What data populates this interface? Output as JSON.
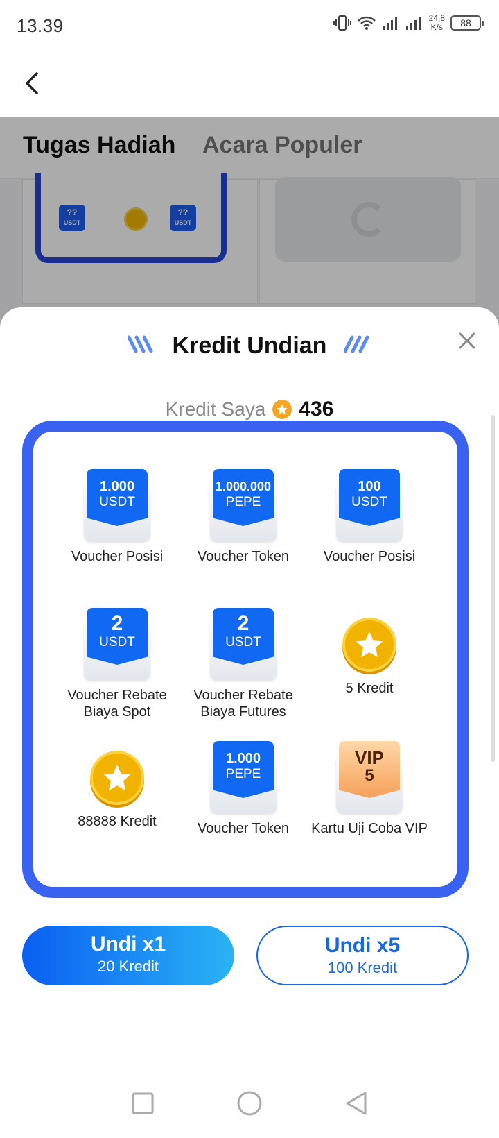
{
  "status_bar": {
    "time": "13.39",
    "net_speed_value": "24,8",
    "net_speed_unit": "K/s",
    "battery": "88"
  },
  "tabs": [
    {
      "label": "Tugas Hadiah"
    },
    {
      "label": "Acara Populer"
    }
  ],
  "background_card": {
    "mini_voucher_label_1": "??",
    "mini_voucher_unit_1": "USDT",
    "mini_voucher_label_2": "??",
    "mini_voucher_unit_2": "USDT"
  },
  "sheet": {
    "title": "Kredit Undian",
    "credit_label": "Kredit Saya",
    "credit_value": "436",
    "prizes": [
      {
        "kind": "voucher",
        "amount": "1.000",
        "unit": "USDT",
        "label": "Voucher Posisi"
      },
      {
        "kind": "voucher",
        "amount": "1.000.000",
        "unit": "PEPE",
        "label": "Voucher Token"
      },
      {
        "kind": "voucher",
        "amount": "100",
        "unit": "USDT",
        "label": "Voucher Posisi"
      },
      {
        "kind": "voucher",
        "amount": "2",
        "unit": "USDT",
        "label": "Voucher Rebate Biaya Spot"
      },
      {
        "kind": "voucher",
        "amount": "2",
        "unit": "USDT",
        "label": "Voucher Rebate Biaya Futures"
      },
      {
        "kind": "coin",
        "label": "5 Kredit"
      },
      {
        "kind": "coin",
        "label": "88888 Kredit"
      },
      {
        "kind": "voucher",
        "amount": "1.000",
        "unit": "PEPE",
        "label": "Voucher Token"
      },
      {
        "kind": "vip",
        "amount": "VIP",
        "unit": "5",
        "label": "Kartu Uji Coba VIP"
      }
    ],
    "buttons": [
      {
        "main": "Undi x1",
        "sub": "20 Kredit"
      },
      {
        "main": "Undi x5",
        "sub": "100 Kredit"
      }
    ]
  },
  "colors": {
    "frame": "#3a62f0",
    "primary": "#1169f3",
    "coin": "#f2b300"
  },
  "icons": {
    "back": "chevron-left-icon",
    "close": "close-icon",
    "credit": "star-coin-icon"
  }
}
